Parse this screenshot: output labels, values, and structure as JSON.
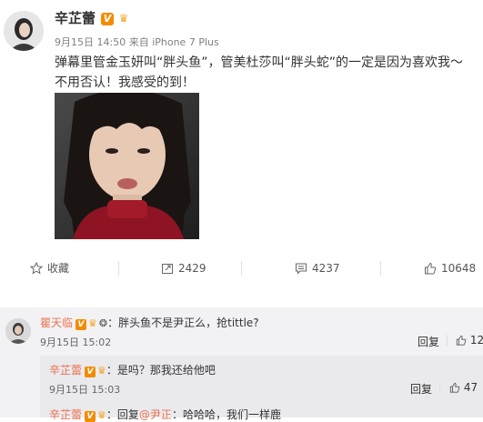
{
  "post": {
    "username": "辛芷蕾",
    "verified_badge": "V",
    "time": "9月15日 14:50",
    "source": "来自 iPhone 7 Plus",
    "text": "弹幕里管金玉妍叫“胖头鱼”，管美杜莎叫“胖头蛇”的一定是因为喜欢我～不用否认！我感受的到！"
  },
  "actions": {
    "favorite_label": "收藏",
    "repost_count": "2429",
    "comment_count": "4237",
    "like_count": "10648"
  },
  "comments": [
    {
      "username": "瞿天临",
      "separator": "：",
      "text": "胖头鱼不是尹正么，抢tittle?",
      "time": "9月15日 15:02",
      "reply_label": "回复",
      "like_count": "12"
    }
  ],
  "replies": [
    {
      "username": "辛芷蕾",
      "separator": "：",
      "text": "是吗？那我还给他吧",
      "time": "9月15日 15:03",
      "reply_label": "回复",
      "like_count": "47"
    },
    {
      "username": "辛芷蕾",
      "separator": "：",
      "prefix": "回复",
      "mention": "@尹正",
      "text": "：哈哈哈，我们一样鹿"
    }
  ],
  "colors": {
    "accent": "#eb7350",
    "verified": "#f28c00",
    "comment_bg": "#f2f2f5"
  }
}
